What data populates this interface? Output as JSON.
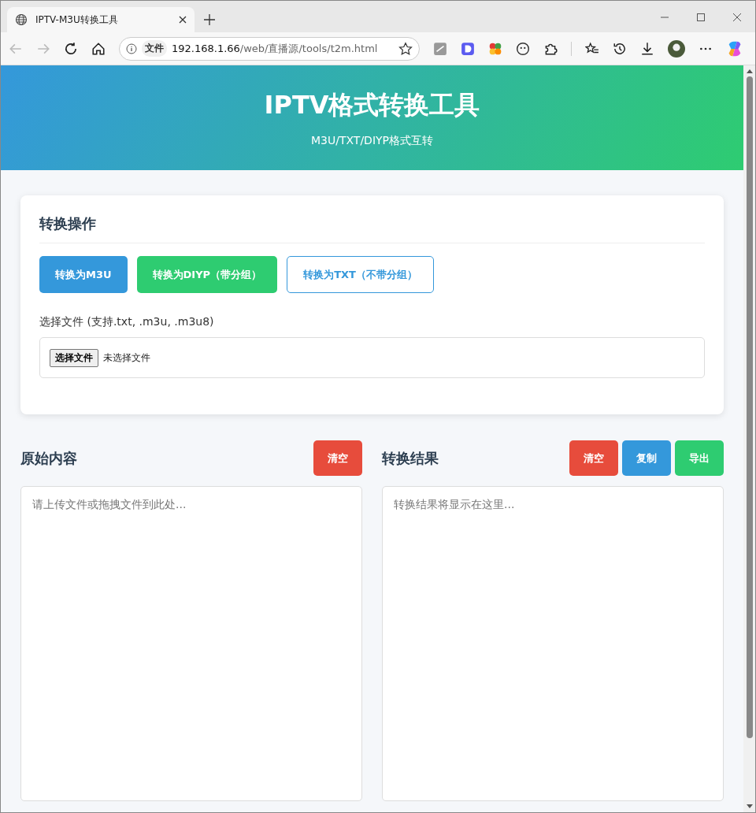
{
  "browser": {
    "tab_title": "IPTV-M3U转换工具",
    "address": {
      "security_label": "文件",
      "host": "192.168.1.66",
      "path": "/web/直播源/tools/t2m.html"
    }
  },
  "header": {
    "title": "IPTV格式转换工具",
    "subtitle": "M3U/TXT/DIYP格式互转"
  },
  "card": {
    "title": "转换操作",
    "convert_buttons": [
      {
        "label": "转换为M3U",
        "kind": "primary"
      },
      {
        "label": "转换为DIYP（带分组）",
        "kind": "success"
      },
      {
        "label": "转换为TXT（不带分组）",
        "kind": "outline"
      }
    ],
    "file_label": "选择文件 (支持.txt, .m3u, .m3u8)",
    "file_input": {
      "button": "选择文件",
      "status": "未选择文件"
    }
  },
  "panels": [
    {
      "title": "原始内容",
      "buttons": [
        {
          "label": "清空",
          "kind": "danger"
        }
      ],
      "placeholder": "请上传文件或拖拽文件到此处..."
    },
    {
      "title": "转换结果",
      "buttons": [
        {
          "label": "清空",
          "kind": "danger"
        },
        {
          "label": "复制",
          "kind": "primary"
        },
        {
          "label": "导出",
          "kind": "success"
        }
      ],
      "placeholder": "转换结果将显示在这里..."
    }
  ]
}
